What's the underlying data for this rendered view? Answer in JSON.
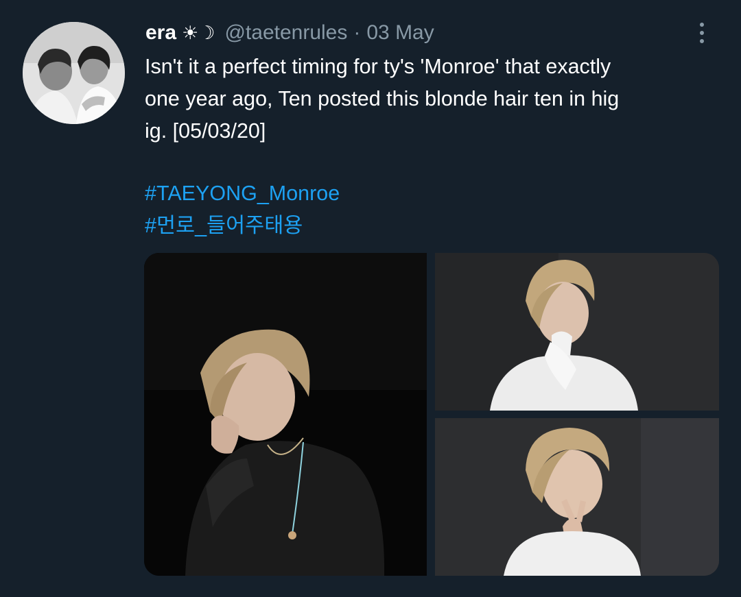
{
  "tweet": {
    "display_name": "era",
    "name_emoji": "☀︎☽",
    "handle": "@taetenrules",
    "separator": "·",
    "timestamp": "03 May",
    "text_lines": [
      "Isn't it a perfect timing for ty's 'Monroe' that exactly",
      "one year ago, Ten posted this blonde hair ten in hig",
      "ig. [05/03/20]"
    ],
    "hashtags": [
      "#TAEYONG_Monroe",
      "#먼로_들어주태용"
    ]
  },
  "icons": {
    "more": "more-vertical-icon",
    "avatar": "profile-avatar"
  },
  "colors": {
    "background": "#15202b",
    "text_primary": "#ffffff",
    "text_secondary": "#8899a6",
    "link": "#1da1f2"
  }
}
